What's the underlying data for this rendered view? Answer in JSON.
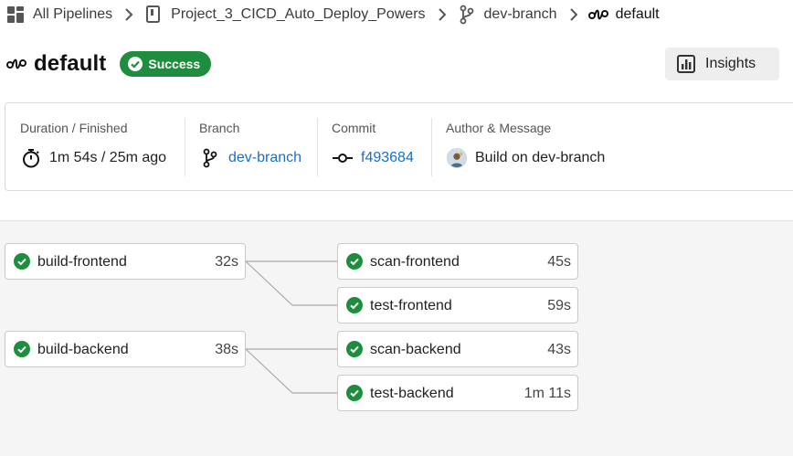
{
  "breadcrumb": {
    "items": [
      {
        "label": "All Pipelines",
        "icon": "pipelines-grid-icon"
      },
      {
        "label": "Project_3_CICD_Auto_Deploy_Powers",
        "icon": "repository-icon"
      },
      {
        "label": "dev-branch",
        "icon": "branch-icon"
      },
      {
        "label": "default",
        "icon": "pipeline-icon"
      }
    ]
  },
  "header": {
    "title": "default",
    "status": "Success",
    "insights_label": "Insights"
  },
  "summary": {
    "duration_label": "Duration / Finished",
    "duration_value": "1m 54s / 25m ago",
    "branch_label": "Branch",
    "branch_value": "dev-branch",
    "commit_label": "Commit",
    "commit_value": "f493684",
    "author_label": "Author & Message",
    "author_message": "Build on dev-branch"
  },
  "steps": [
    {
      "name": "build-frontend",
      "duration": "32s",
      "status": "success"
    },
    {
      "name": "scan-frontend",
      "duration": "45s",
      "status": "success"
    },
    {
      "name": "test-frontend",
      "duration": "59s",
      "status": "success"
    },
    {
      "name": "build-backend",
      "duration": "38s",
      "status": "success"
    },
    {
      "name": "scan-backend",
      "duration": "43s",
      "status": "success"
    },
    {
      "name": "test-backend",
      "duration": "1m 11s",
      "status": "success"
    }
  ],
  "colors": {
    "success": "#1e8e3e",
    "link": "#1a6fc4",
    "graph_background": "#f5f5f5"
  }
}
